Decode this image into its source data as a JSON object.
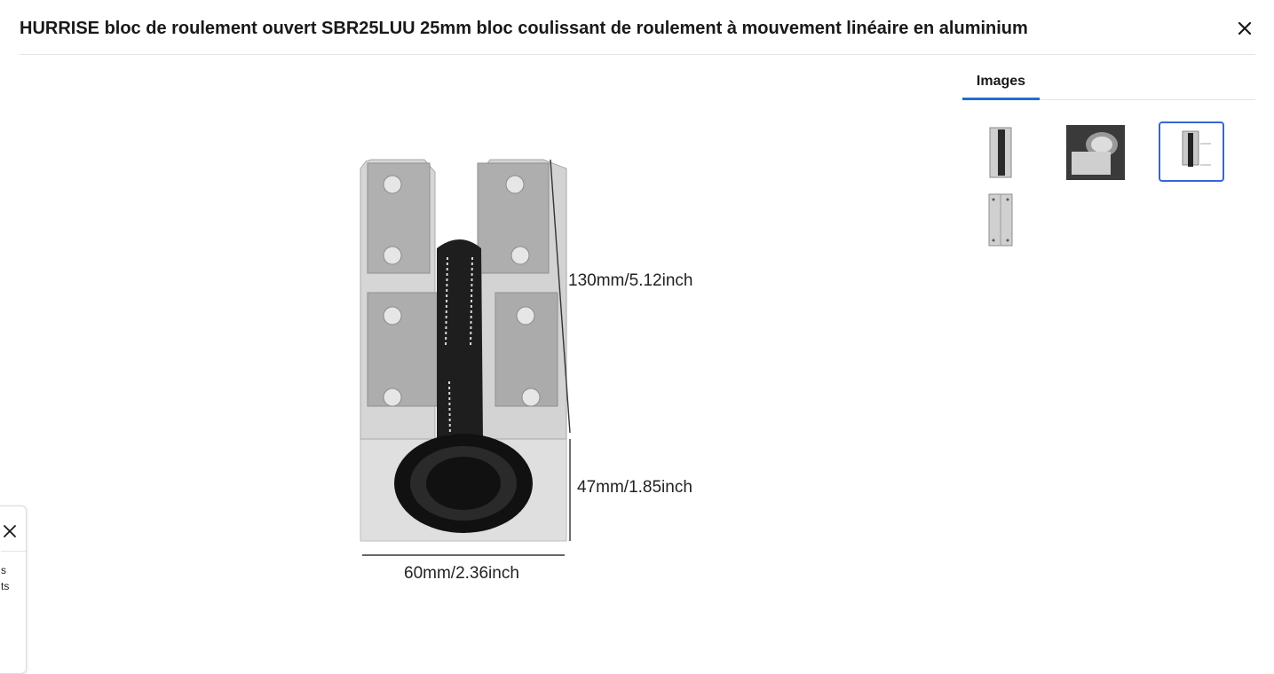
{
  "header": {
    "title": "HURRISE bloc de roulement ouvert SBR25LUU 25mm bloc coulissant de roulement à mouvement linéaire en aluminium",
    "close_icon": "close-icon"
  },
  "tabs": [
    {
      "label": "Images",
      "active": true
    }
  ],
  "thumbnails": [
    {
      "icon": "bearing-block-upright-thumbnail",
      "selected": false
    },
    {
      "icon": "bearing-block-closeup-thumbnail",
      "selected": false
    },
    {
      "icon": "bearing-block-dimensions-thumbnail",
      "selected": true
    },
    {
      "icon": "bearing-block-top-thumbnail",
      "selected": false
    }
  ],
  "main_image": {
    "dimensions": {
      "length": "130mm/5.12inch",
      "height": "47mm/1.85inch",
      "width": "60mm/2.36inch"
    }
  },
  "side_panel": {
    "close_icon": "close-icon",
    "lines": [
      "s",
      "ts"
    ]
  },
  "colors": {
    "accent": "#1f6fd1",
    "selected_border": "#3665d8",
    "divider": "#e5e5e5"
  }
}
